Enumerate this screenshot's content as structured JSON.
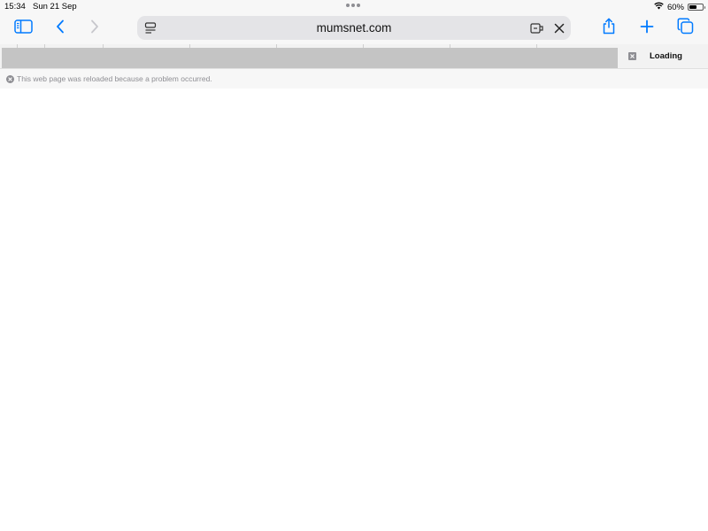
{
  "status_bar": {
    "time": "15:34",
    "date": "Sun 21 Sep",
    "battery_percent": "60%",
    "battery_level": 0.6
  },
  "toolbar": {
    "address": "mumsnet.com",
    "accent_color": "#007aff",
    "icons": {
      "sidebar": "sidebar-icon",
      "back": "chevron-left-icon",
      "forward": "chevron-right-icon",
      "page_menu": "page-menu-icon",
      "extension": "extension-icon",
      "stop": "close-icon",
      "share": "share-icon",
      "new_tab": "plus-icon",
      "tabs": "tabs-overview-icon"
    }
  },
  "tabs": {
    "active_title": "Loading"
  },
  "notice": {
    "text": "This web page was reloaded because a problem occurred."
  }
}
